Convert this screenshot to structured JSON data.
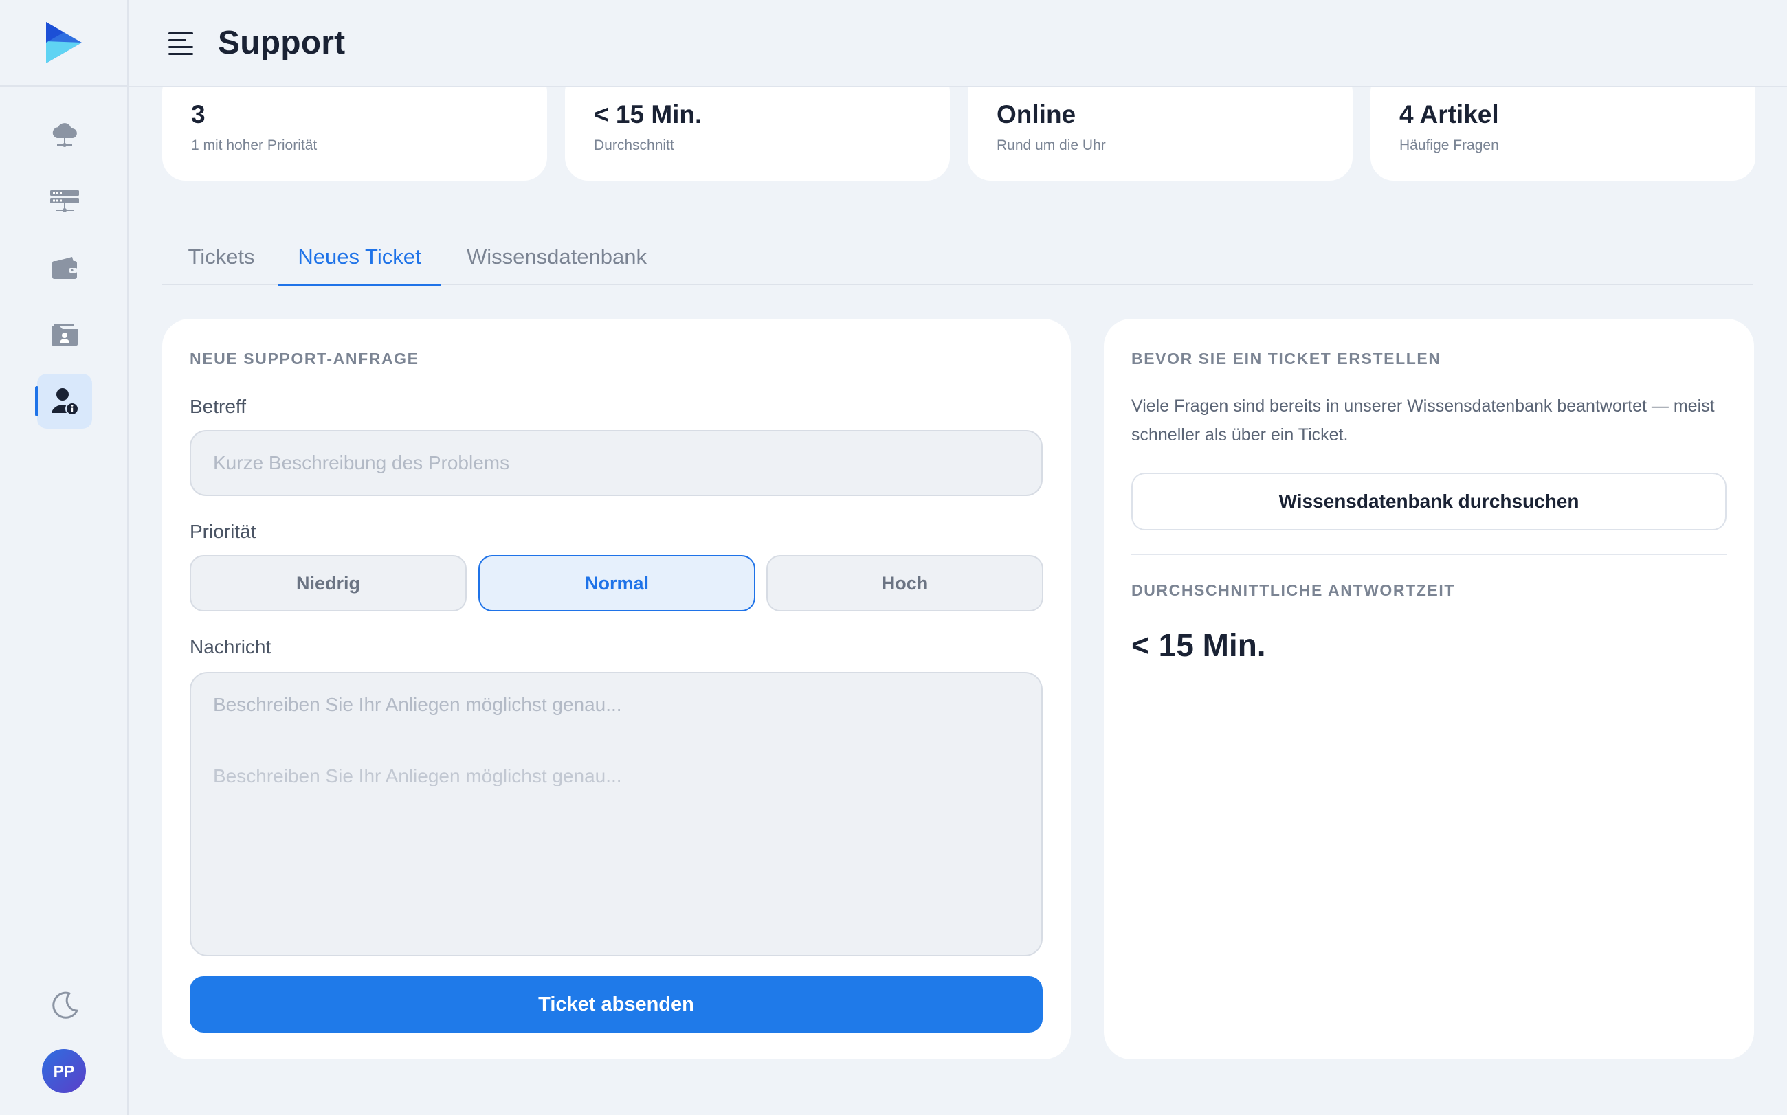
{
  "header": {
    "title": "Support"
  },
  "stats": [
    {
      "value": "3",
      "sub": "1 mit hoher Priorität"
    },
    {
      "value": "< 15 Min.",
      "sub": "Durchschnitt"
    },
    {
      "value": "Online",
      "sub": "Rund um die Uhr"
    },
    {
      "value": "4 Artikel",
      "sub": "Häufige Fragen"
    }
  ],
  "tabs": [
    {
      "label": "Tickets"
    },
    {
      "label": "Neues Ticket"
    },
    {
      "label": "Wissensdatenbank"
    }
  ],
  "active_tab": "Neues Ticket",
  "sidebar": {
    "items": [
      {
        "icon": "cloud-icon"
      },
      {
        "icon": "server-icon"
      },
      {
        "icon": "wallet-icon"
      },
      {
        "icon": "folder-user-icon"
      },
      {
        "icon": "user-info-icon",
        "active": true
      }
    ],
    "avatar_initials": "PP"
  },
  "form": {
    "section_title": "NEUE SUPPORT-ANFRAGE",
    "subject_label": "Betreff",
    "subject_placeholder": "Kurze Beschreibung des Problems",
    "subject_value": "",
    "priority_label": "Priorität",
    "priority_options": [
      "Niedrig",
      "Normal",
      "Hoch"
    ],
    "priority_selected": "Normal",
    "message_label": "Nachricht",
    "message_placeholder": "Beschreiben Sie Ihr Anliegen möglichst genau...",
    "submit_label": "Ticket absenden"
  },
  "aside": {
    "section_title": "BEVOR SIE EIN TICKET ERSTELLEN",
    "help_text": "Viele Fragen sind bereits in unserer Wissensdatenbank beantwortet — meist schneller als über ein Ticket.",
    "kb_button_label": "Wissensdatenbank durchsuchen",
    "response_title": "DURCHSCHNITTLICHE ANTWORTZEIT",
    "response_value": "< 15 Min."
  },
  "colors": {
    "accent": "#1f73e8",
    "background": "#eff3f8",
    "card": "#ffffff"
  }
}
